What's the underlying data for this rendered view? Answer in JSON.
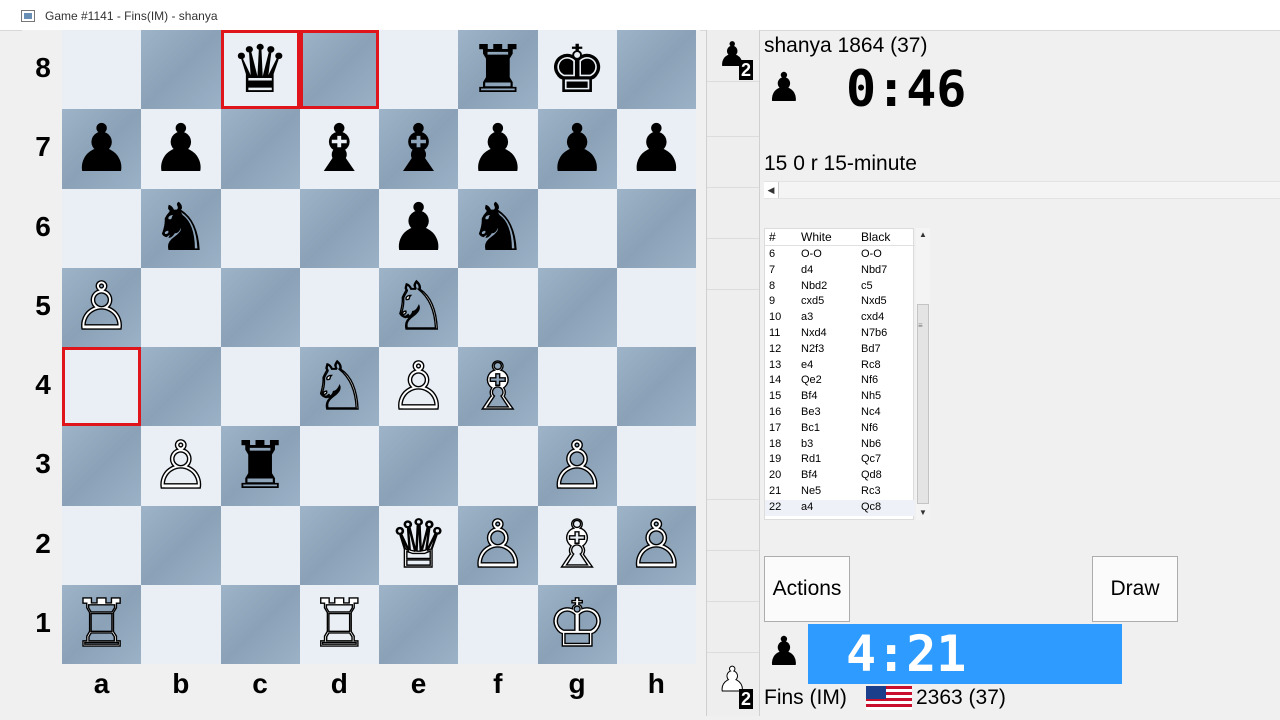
{
  "window": {
    "title": "Game #1141 - Fins(IM) - shanya"
  },
  "board": {
    "ranks": [
      "8",
      "7",
      "6",
      "5",
      "4",
      "3",
      "2",
      "1"
    ],
    "files": [
      "a",
      "b",
      "c",
      "d",
      "e",
      "f",
      "g",
      "h"
    ],
    "highlighted_squares": [
      "c8",
      "d8",
      "a4"
    ],
    "pieces": [
      {
        "square": "c8",
        "color": "black",
        "piece": "queen"
      },
      {
        "square": "f8",
        "color": "black",
        "piece": "rook"
      },
      {
        "square": "g8",
        "color": "black",
        "piece": "king"
      },
      {
        "square": "a7",
        "color": "black",
        "piece": "pawn"
      },
      {
        "square": "b7",
        "color": "black",
        "piece": "pawn"
      },
      {
        "square": "d7",
        "color": "black",
        "piece": "bishop"
      },
      {
        "square": "e7",
        "color": "black",
        "piece": "bishop"
      },
      {
        "square": "f7",
        "color": "black",
        "piece": "pawn"
      },
      {
        "square": "g7",
        "color": "black",
        "piece": "pawn"
      },
      {
        "square": "h7",
        "color": "black",
        "piece": "pawn"
      },
      {
        "square": "b6",
        "color": "black",
        "piece": "knight"
      },
      {
        "square": "e6",
        "color": "black",
        "piece": "pawn"
      },
      {
        "square": "f6",
        "color": "black",
        "piece": "knight"
      },
      {
        "square": "a5",
        "color": "white",
        "piece": "pawn"
      },
      {
        "square": "e5",
        "color": "white",
        "piece": "knight"
      },
      {
        "square": "d4",
        "color": "white",
        "piece": "knight"
      },
      {
        "square": "e4",
        "color": "white",
        "piece": "pawn"
      },
      {
        "square": "f4",
        "color": "white",
        "piece": "bishop"
      },
      {
        "square": "b3",
        "color": "white",
        "piece": "pawn"
      },
      {
        "square": "c3",
        "color": "black",
        "piece": "rook"
      },
      {
        "square": "g3",
        "color": "white",
        "piece": "pawn"
      },
      {
        "square": "e2",
        "color": "white",
        "piece": "queen"
      },
      {
        "square": "f2",
        "color": "white",
        "piece": "pawn"
      },
      {
        "square": "g2",
        "color": "white",
        "piece": "bishop"
      },
      {
        "square": "h2",
        "color": "white",
        "piece": "pawn"
      },
      {
        "square": "a1",
        "color": "white",
        "piece": "rook"
      },
      {
        "square": "d1",
        "color": "white",
        "piece": "rook"
      },
      {
        "square": "g1",
        "color": "white",
        "piece": "king"
      }
    ]
  },
  "captured": {
    "top": {
      "piece": "pawn",
      "color": "black",
      "count": "2"
    },
    "bottom": {
      "piece": "pawn",
      "color": "white",
      "count": "2"
    }
  },
  "top_player": {
    "name": "shanya 1864 (37)",
    "clock": "0:46"
  },
  "bottom_player": {
    "name": "Fins (IM)",
    "rating": "2363 (37)",
    "clock": "4:21",
    "flag": "us-flag"
  },
  "game_type": "15 0 r 15-minute",
  "moves_table": {
    "headers": {
      "num": "#",
      "white": "White",
      "black": "Black"
    },
    "rows": [
      {
        "n": "6",
        "w": "O-O",
        "b": "O-O"
      },
      {
        "n": "7",
        "w": "d4",
        "b": "Nbd7"
      },
      {
        "n": "8",
        "w": "Nbd2",
        "b": "c5"
      },
      {
        "n": "9",
        "w": "cxd5",
        "b": "Nxd5"
      },
      {
        "n": "10",
        "w": "a3",
        "b": "cxd4"
      },
      {
        "n": "11",
        "w": "Nxd4",
        "b": "N7b6"
      },
      {
        "n": "12",
        "w": "N2f3",
        "b": "Bd7"
      },
      {
        "n": "13",
        "w": "e4",
        "b": "Rc8"
      },
      {
        "n": "14",
        "w": "Qe2",
        "b": "Nf6"
      },
      {
        "n": "15",
        "w": "Bf4",
        "b": "Nh5"
      },
      {
        "n": "16",
        "w": "Be3",
        "b": "Nc4"
      },
      {
        "n": "17",
        "w": "Bc1",
        "b": "Nf6"
      },
      {
        "n": "18",
        "w": "b3",
        "b": "Nb6"
      },
      {
        "n": "19",
        "w": "Rd1",
        "b": "Qc7"
      },
      {
        "n": "20",
        "w": "Bf4",
        "b": "Qd8"
      },
      {
        "n": "21",
        "w": "Ne5",
        "b": "Rc3"
      },
      {
        "n": "22",
        "w": "a4",
        "b": "Qc8"
      }
    ]
  },
  "buttons": {
    "actions": "Actions",
    "draw": "Draw"
  },
  "colors": {
    "light_square": "#e9eff4",
    "dark_square": "#93abc2",
    "highlight": "#e0141b",
    "clock_active": "#2d9bff"
  }
}
